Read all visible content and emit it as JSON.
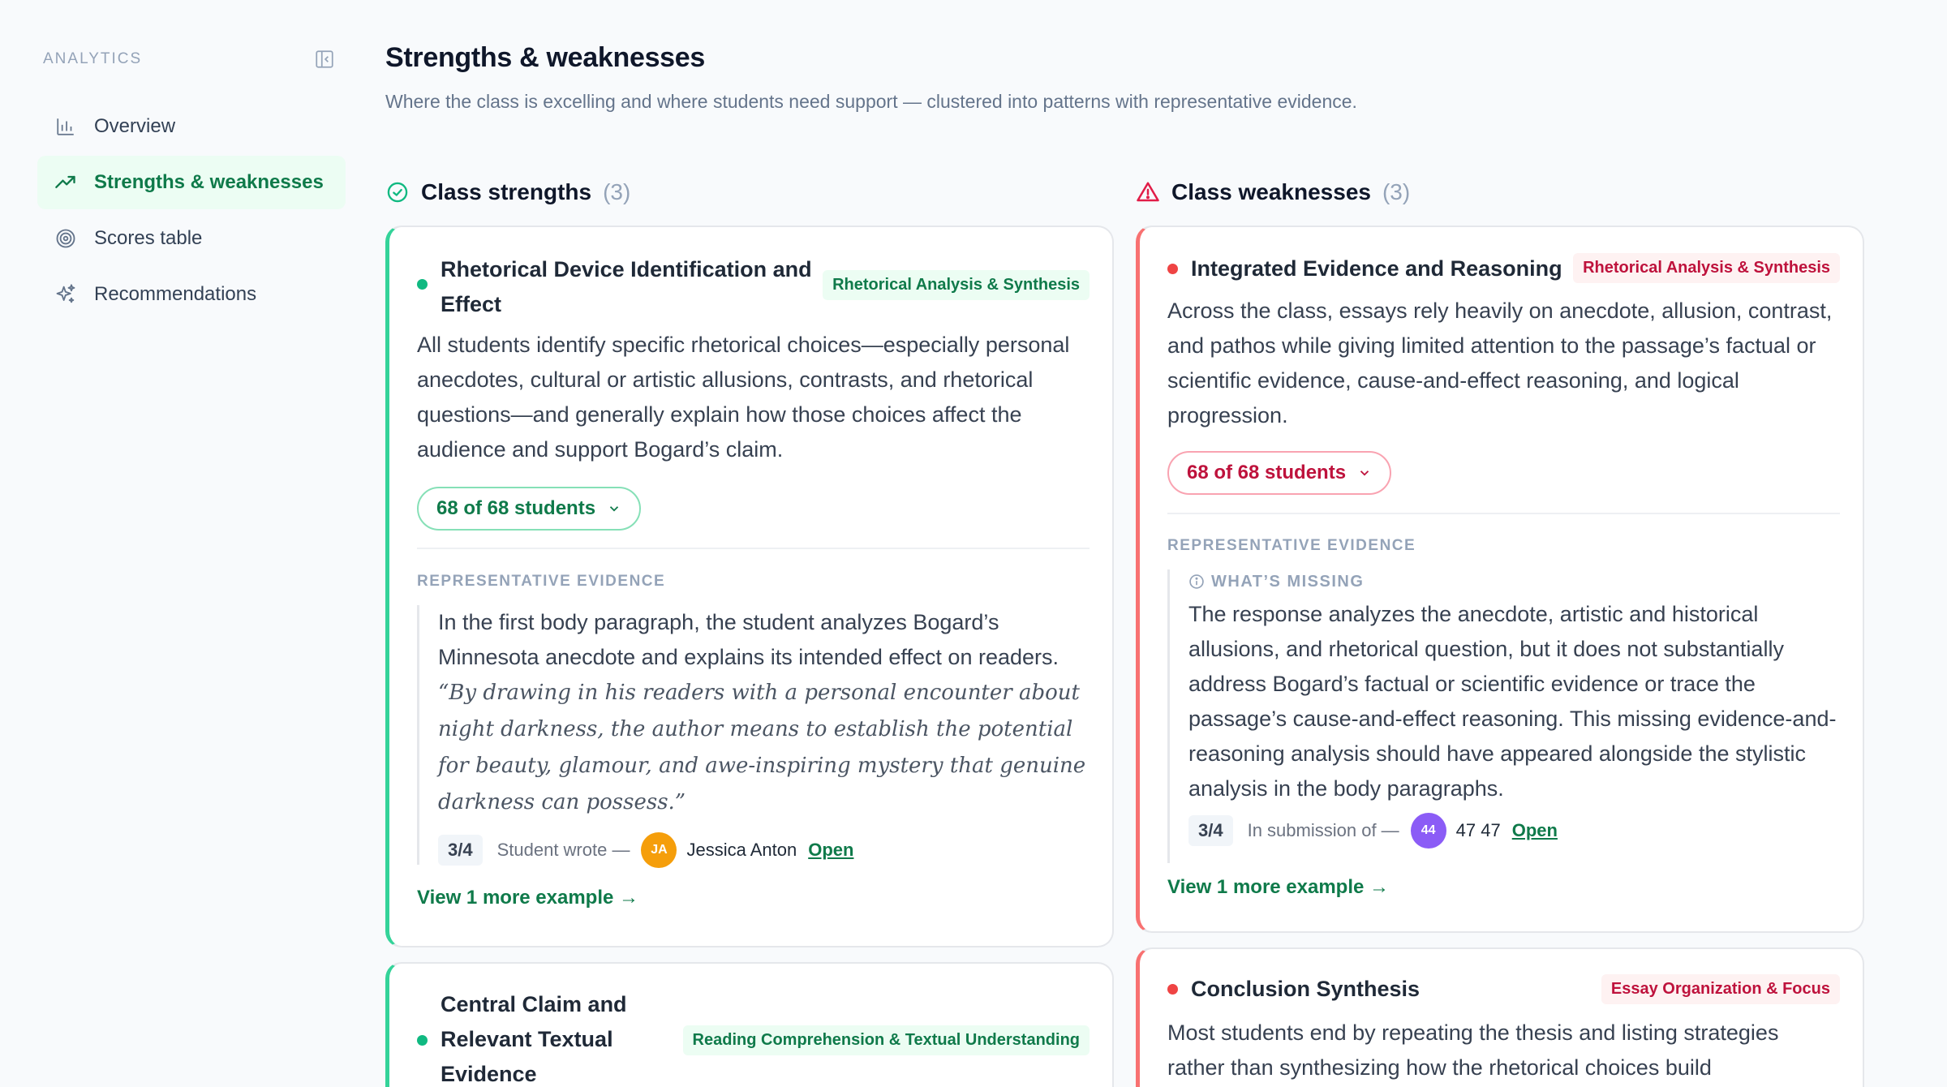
{
  "sidebar": {
    "title": "ANALYTICS",
    "items": [
      {
        "label": "Overview",
        "icon": "bar-chart-icon",
        "active": false
      },
      {
        "label": "Strengths & weaknesses",
        "icon": "trend-up-icon",
        "active": true
      },
      {
        "label": "Scores table",
        "icon": "target-icon",
        "active": false
      },
      {
        "label": "Recommendations",
        "icon": "sparkles-icon",
        "active": false
      }
    ]
  },
  "page": {
    "title": "Strengths & weaknesses",
    "subtitle": "Where the class is excelling and where students need support — clustered into patterns with representative evidence."
  },
  "strengths": {
    "title": "Class strengths",
    "count": "(3)",
    "cards": [
      {
        "title_line1": "Rhetorical Device Identification and",
        "title_line2": "Effect",
        "tag": "Rhetorical Analysis & Synthesis",
        "body": "All students identify specific rhetorical choices—especially personal anecdotes, cultural or artistic allusions, contrasts, and rhetorical questions—and generally explain how those choices affect the audience and support Bogard’s claim.",
        "students": "68 of 68 students",
        "evidence_label": "REPRESENTATIVE EVIDENCE",
        "evidence_text": "In the first body paragraph, the student analyzes Bogard’s Minnesota anecdote and explains its intended effect on readers.",
        "evidence_quote": "“By drawing in his readers with a personal encounter about night darkness, the author means to establish the potential for beauty, glamour, and awe-inspiring mystery that genuine darkness can possess.”",
        "score": "3/4",
        "wrote_label": "Student wrote —",
        "avatar_initials": "JA",
        "student_name": "Jessica Anton",
        "open_label": "Open",
        "more_label": "View 1 more example →"
      },
      {
        "title_line1": "Central Claim and",
        "title_line2": "Relevant Textual",
        "title_line3": "Evidence",
        "tag": "Reading Comprehension & Textual Understanding"
      }
    ]
  },
  "weaknesses": {
    "title": "Class weaknesses",
    "count": "(3)",
    "cards": [
      {
        "title": "Integrated Evidence and Reasoning",
        "tag": "Rhetorical Analysis & Synthesis",
        "body": "Across the class, essays rely heavily on anecdote, allusion, contrast, and pathos while giving limited attention to the passage’s factual or scientific evidence, cause-and-effect reasoning, and logical progression.",
        "students": "68 of 68 students",
        "evidence_label": "REPRESENTATIVE EVIDENCE",
        "missing_label": "WHAT’S MISSING",
        "missing_text": "The response analyzes the anecdote, artistic and historical allusions, and rhetorical question, but it does not substantially address Bogard’s factual or scientific evidence or trace the passage’s cause-and-effect reasoning. This missing evidence-and-reasoning analysis should have appeared alongside the stylistic analysis in the body paragraphs.",
        "score": "3/4",
        "submission_label": "In submission of —",
        "avatar_initials": "44",
        "student_name": "47 47",
        "open_label": "Open",
        "more_label": "View 1 more example →"
      },
      {
        "title": "Conclusion Synthesis",
        "tag": "Essay Organization & Focus",
        "body": "Most students end by repeating the thesis and listing strategies rather than synthesizing how the rhetorical choices build"
      }
    ]
  },
  "colors": {
    "accent_green": "#0f7a4a",
    "accent_red": "#be123c",
    "avatar_orange": "#f59e0b",
    "avatar_purple": "#8b5cf6"
  }
}
